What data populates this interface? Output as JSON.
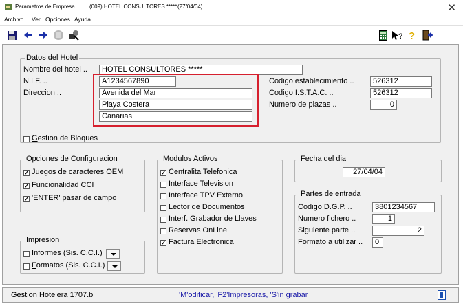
{
  "window": {
    "title_app": "Parametros de Empresa",
    "title_hotel": "(009) HOTEL CONSULTORES *****",
    "title_date": "(27/04/04)"
  },
  "menu": {
    "items": [
      "Archivo",
      "Ver",
      "Opciones",
      "Ayuda"
    ]
  },
  "datos_hotel": {
    "title": "Datos del Hotel",
    "nombre_label": "Nombre del hotel ..",
    "nombre_value": "HOTEL CONSULTORES *****",
    "nif_label": "N.I.F. ..",
    "nif_value": "A1234567890",
    "direccion_label": "Direccion ..",
    "direccion_1": "Avenida del Mar",
    "direccion_2": "Playa Costera",
    "direccion_3": "Canarias",
    "codigo_est_label": "Codigo establecimiento ..",
    "codigo_est_value": "526312",
    "codigo_istac_label": "Codigo I.S.T.A.C. ..",
    "codigo_istac_value": "526312",
    "num_plazas_label": "Numero de plazas ..",
    "num_plazas_value": "0",
    "gestion_bloques_prefix": "G",
    "gestion_bloques_rest": "estion de Bloques"
  },
  "opciones": {
    "title": "Opciones de Configuracion",
    "items": [
      {
        "label": "Juegos de caracteres OEM",
        "checked": true
      },
      {
        "label": "Funcionalidad CCI",
        "checked": true
      },
      {
        "label": "'ENTER' pasar de campo",
        "checked": true
      }
    ]
  },
  "impresion": {
    "title": "Impresion",
    "informes_prefix": "I",
    "informes_rest": "nformes (Sis. C.C.I.)",
    "formatos_prefix": "F",
    "formatos_rest": "ormatos (Sis. C.C.I.)"
  },
  "modulos": {
    "title": "Modulos Activos",
    "items": [
      {
        "label": "Centralita Telefonica",
        "checked": true
      },
      {
        "label": "Interface Television",
        "checked": false
      },
      {
        "label": "Interface TPV Externo",
        "checked": false
      },
      {
        "label": "Lector de Documentos",
        "checked": false
      },
      {
        "label": "Interf. Grabador de Llaves",
        "checked": false
      },
      {
        "label": "Reservas OnLine",
        "checked": false
      },
      {
        "label": "Factura Electronica",
        "checked": true
      }
    ]
  },
  "fecha": {
    "title": "Fecha del dia",
    "value": "27/04/04"
  },
  "partes": {
    "title": "Partes de entrada",
    "codigo_dgp_label": "Codigo D.G.P. ..",
    "codigo_dgp_value": "3801234567",
    "numero_fichero_label": "Numero fichero ..",
    "numero_fichero_value": "1",
    "siguiente_parte_label": "Siguiente parte ..",
    "siguiente_parte_value": "2",
    "formato_label": "Formato a utilizar ..",
    "formato_value": "0"
  },
  "status": {
    "app_version": "Gestion Hotelera 1707.b",
    "hint": "'M'odificar, 'F2'Impresoras, 'S'in grabar"
  },
  "colors": {
    "highlight": "#d6202e",
    "hint_text": "#1a1aa8"
  }
}
